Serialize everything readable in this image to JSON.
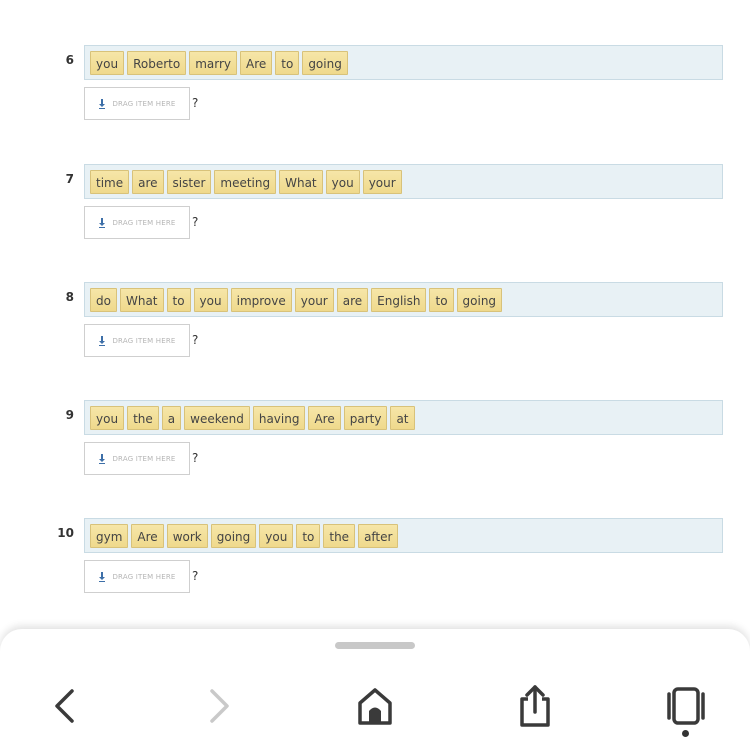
{
  "drop_zone_label": "DRAG ITEM HERE",
  "question_mark": "?",
  "questions": [
    {
      "number": "6",
      "words": [
        "you",
        "Roberto",
        "marry",
        "Are",
        "to",
        "going"
      ]
    },
    {
      "number": "7",
      "words": [
        "time",
        "are",
        "sister",
        "meeting",
        "What",
        "you",
        "your"
      ]
    },
    {
      "number": "8",
      "words": [
        "do",
        "What",
        "to",
        "you",
        "improve",
        "your",
        "are",
        "English",
        "to",
        "going"
      ]
    },
    {
      "number": "9",
      "words": [
        "you",
        "the",
        "a",
        "weekend",
        "having",
        "Are",
        "party",
        "at"
      ]
    },
    {
      "number": "10",
      "words": [
        "gym",
        "Are",
        "work",
        "going",
        "you",
        "to",
        "the",
        "after"
      ]
    }
  ],
  "browser_nav": {
    "buttons": [
      {
        "icon": "back-arrow-icon",
        "enabled": true
      },
      {
        "icon": "forward-arrow-icon",
        "enabled": false
      },
      {
        "icon": "home-icon",
        "enabled": true
      },
      {
        "icon": "share-icon",
        "enabled": true
      },
      {
        "icon": "tabs-icon",
        "enabled": true
      }
    ]
  },
  "colors": {
    "chip_fill": "#f2df98",
    "chip_border": "#d8c27a",
    "bank_fill": "#e8f1f5",
    "bank_border": "#c9dbe4"
  }
}
